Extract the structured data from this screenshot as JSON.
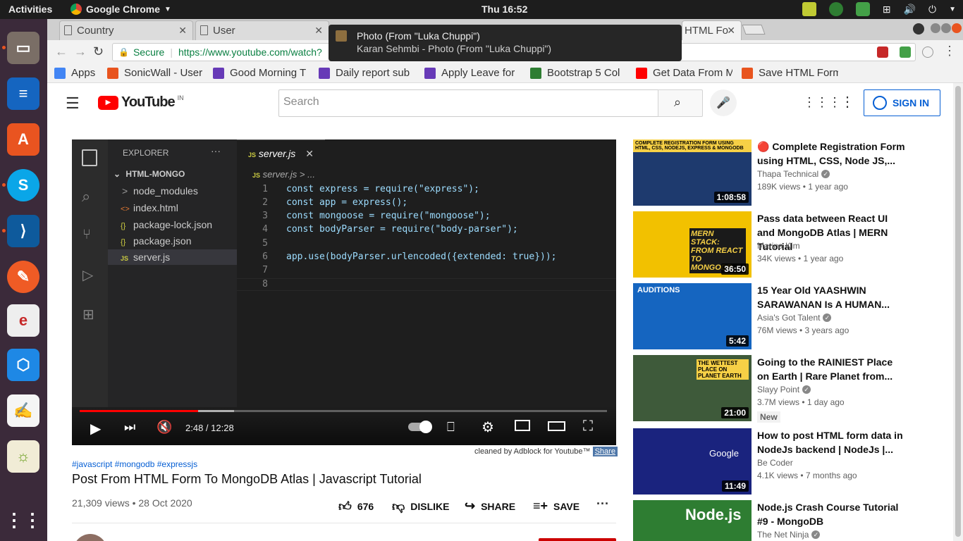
{
  "topbar": {
    "activities": "Activities",
    "app_name": "Google Chrome",
    "clock": "Thu 16:52"
  },
  "tabs": [
    {
      "label": "Country"
    },
    {
      "label": "User"
    },
    {
      "label": "HTML Fo"
    }
  ],
  "notification": {
    "title": "Photo (From \"Luka Chuppi\")",
    "body": "Karan Sehmbi - Photo (From \"Luka Chuppi\")"
  },
  "omnibox": {
    "secure_label": "Secure",
    "url": "https://www.youtube.com/watch?"
  },
  "bookmarks": [
    {
      "label": "Apps",
      "color": "#4285f4"
    },
    {
      "label": "SonicWall - User",
      "color": "#e8541e"
    },
    {
      "label": "Good Morning T",
      "color": "#673ab7"
    },
    {
      "label": "Daily report sub",
      "color": "#673ab7"
    },
    {
      "label": "Apply Leave for",
      "color": "#673ab7"
    },
    {
      "label": "Bootstrap 5 Col",
      "color": "#2e7d32"
    },
    {
      "label": "Get Data From M",
      "color": "#ff0000"
    },
    {
      "label": "Save HTML Form",
      "color": "#e8541e"
    }
  ],
  "youtube": {
    "logo_text": "YouTube",
    "region": "IN",
    "search_placeholder": "Search",
    "sign_in": "SIGN IN"
  },
  "player": {
    "explorer_title": "EXPLORER",
    "tab_label": "server.js",
    "breadcrumb": "server.js > ...",
    "folder": "HTML-MONGO",
    "files": [
      {
        "name": "node_modules",
        "icon": ">"
      },
      {
        "name": "index.html",
        "icon": "<>"
      },
      {
        "name": "package-lock.json",
        "icon": "{}"
      },
      {
        "name": "package.json",
        "icon": "{}"
      },
      {
        "name": "server.js",
        "icon": "JS"
      }
    ],
    "code_lines": [
      {
        "n": "1",
        "text": "const express = require(\"express\");"
      },
      {
        "n": "2",
        "text": "const app = express();"
      },
      {
        "n": "3",
        "text": "const mongoose = require(\"mongoose\");"
      },
      {
        "n": "4",
        "text": "const bodyParser = require(\"body-parser\");"
      },
      {
        "n": "5",
        "text": ""
      },
      {
        "n": "6",
        "text": "app.use(bodyParser.urlencoded({extended: true}));"
      },
      {
        "n": "7",
        "text": ""
      },
      {
        "n": "8",
        "text": ""
      }
    ],
    "time": "2:48 / 12:28",
    "progress": 0.224,
    "buffered": 0.293
  },
  "adblock": {
    "text": "cleaned by Adblock for Youtube™",
    "share": "Share"
  },
  "video": {
    "hashtags": "#javascript #mongodb #expressjs",
    "title": "Post From HTML Form To MongoDB Atlas | Javascript Tutorial",
    "stats": "21,309 views • 28 Oct 2020",
    "likes": "676",
    "dislike": "DISLIKE",
    "share": "SHARE",
    "save": "SAVE"
  },
  "recommendations": [
    {
      "title": "🔴 Complete Registration Form using HTML, CSS, Node JS,...",
      "channel": "Thapa Technical",
      "verified": true,
      "meta": "189K views • 1 year ago",
      "duration": "1:08:58",
      "badge": "",
      "thumb_color": "#1e3a6e",
      "thumb_text": "COMPLETE REGISTRATION FORM USING HTML, CSS, NODEJS, EXPRESS & MONGODB"
    },
    {
      "title": "Pass data between React UI and MongoDB Atlas | MERN Tutorial",
      "channel": "Marina Kim",
      "verified": false,
      "meta": "34K views • 1 year ago",
      "duration": "36:50",
      "badge": "",
      "thumb_color": "#f2c100",
      "thumb_text": "MERN STACK: FROM REACT TO MONGODB"
    },
    {
      "title": "15 Year Old YAASHWIN SARAWANAN Is A HUMAN...",
      "channel": "Asia's Got Talent",
      "verified": true,
      "meta": "76M views • 3 years ago",
      "duration": "5:42",
      "badge": "",
      "thumb_color": "#1565c0",
      "thumb_text": "AUDITIONS"
    },
    {
      "title": "Going to the RAINIEST Place on Earth | Rare Planet from...",
      "channel": "Slayy Point",
      "verified": true,
      "meta": "3.7M views • 1 day ago",
      "duration": "21:00",
      "badge": "New",
      "thumb_color": "#3e5a3a",
      "thumb_text": "THE WETTEST PLACE ON PLANET EARTH"
    },
    {
      "title": "How to post HTML form data in NodeJs backend | NodeJs |...",
      "channel": "Be Coder",
      "verified": false,
      "meta": "4.1K views • 7 months ago",
      "duration": "11:49",
      "badge": "",
      "thumb_color": "#1a237e",
      "thumb_text": "Google"
    },
    {
      "title": "Node.js Crash Course Tutorial #9 - MongoDB",
      "channel": "The Net Ninja",
      "verified": true,
      "meta": "",
      "duration": "",
      "badge": "",
      "thumb_color": "#2e7d32",
      "thumb_text": "Node.js"
    }
  ]
}
